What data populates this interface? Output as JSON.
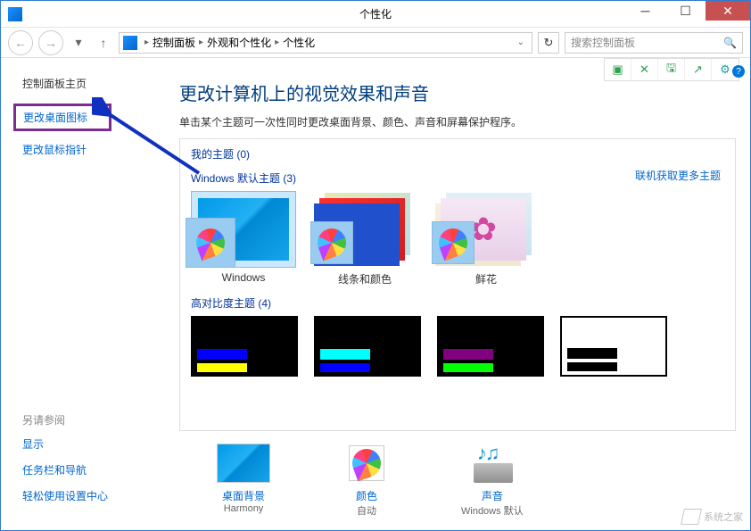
{
  "window": {
    "title": "个性化"
  },
  "breadcrumb": {
    "items": [
      "控制面板",
      "外观和个性化",
      "个性化"
    ]
  },
  "search": {
    "placeholder": "搜索控制面板"
  },
  "sidebar": {
    "heading": "控制面板主页",
    "links": {
      "change_desktop_icons": "更改桌面图标",
      "change_mouse_pointers": "更改鼠标指针"
    },
    "see_also_heading": "另请参阅",
    "see_also": {
      "display": "显示",
      "taskbar_nav": "任务栏和导航",
      "ease_of_access": "轻松使用设置中心"
    }
  },
  "main": {
    "heading": "更改计算机上的视觉效果和声音",
    "desc": "单击某个主题可一次性同时更改桌面背景、颜色、声音和屏幕保护程序。"
  },
  "sections": {
    "my_themes": "我的主题 (0)",
    "online_link": "联机获取更多主题",
    "default_themes": "Windows 默认主题 (3)",
    "high_contrast": "高对比度主题 (4)"
  },
  "themes": {
    "windows": "Windows",
    "lines_colors": "线条和颜色",
    "flowers": "鲜花"
  },
  "settings": {
    "background": {
      "label": "桌面背景",
      "value": "Harmony"
    },
    "color": {
      "label": "颜色",
      "value": "自动"
    },
    "sound": {
      "label": "声音",
      "value": "Windows 默认"
    }
  },
  "watermark": "系统之家"
}
